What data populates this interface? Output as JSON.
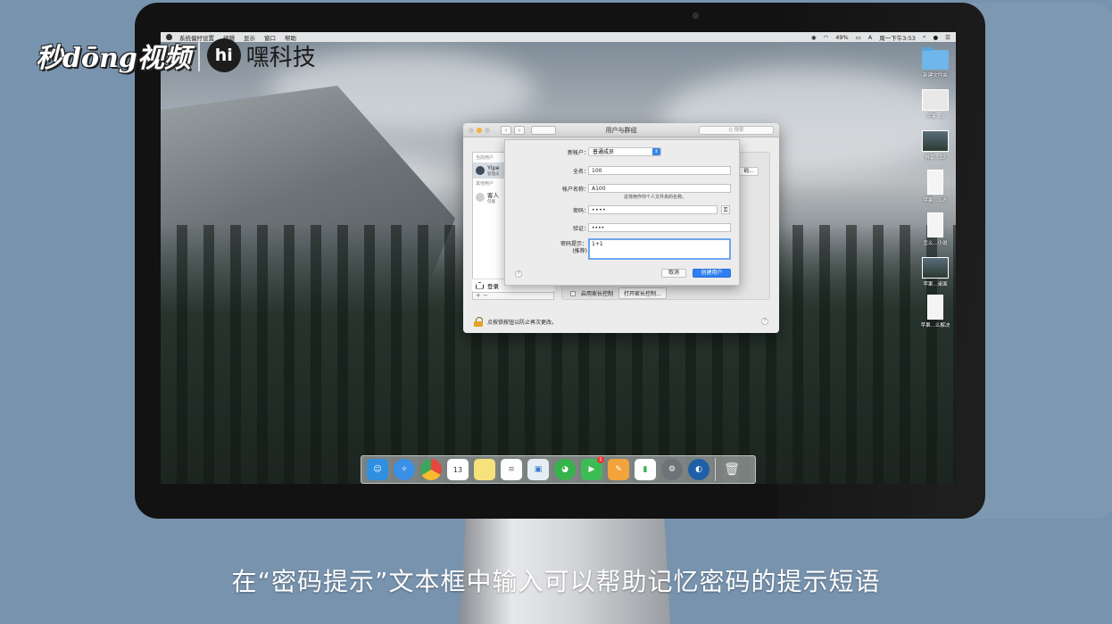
{
  "watermark": {
    "logo": "秒dōng视频",
    "hi": "hi",
    "name": "嘿科技"
  },
  "menubar": {
    "items": [
      "系统偏好设置",
      "编辑",
      "显示",
      "窗口",
      "帮助"
    ],
    "battery": "49%",
    "clock": "周一下午3:53",
    "input_method": "A"
  },
  "desktop": {
    "files": [
      {
        "label": "新建文件夹",
        "kind": "folder"
      },
      {
        "label": "苹果...1",
        "kind": "thumb"
      },
      {
        "label": "屏幕...22",
        "kind": "dark"
      },
      {
        "label": "苹果...么办",
        "kind": "tall"
      },
      {
        "label": "怎么...小说",
        "kind": "tall"
      },
      {
        "label": "苹果...桌面",
        "kind": "dark"
      },
      {
        "label": "苹果...么解决",
        "kind": "tall"
      }
    ]
  },
  "window": {
    "title": "用户与群组",
    "search_placeholder": "Q 搜索",
    "current_users_header": "当前用户",
    "current_user_name": "Yipe",
    "current_user_role": "管理员",
    "other_users_header": "其他用户",
    "guest_name": "客人",
    "guest_role": "仅能",
    "login_label": "登录",
    "plus_minus": "+ −",
    "right_button": "码...",
    "parental_checkbox": "启用家长控制",
    "parental_button": "打开家长控制...",
    "lock_text": "点按锁按钮以防止再次更改。",
    "help": "?"
  },
  "sheet": {
    "new_account_label": "新帐户：",
    "new_account_value": "普通成员",
    "fullname_label": "全名：",
    "fullname_value": "100",
    "account_label": "帐户名称：",
    "account_value": "A100",
    "account_hint": "这将用作你个人文件夹的名称。",
    "password_label": "密码：",
    "password_value": "••••",
    "verify_label": "验证：",
    "verify_value": "••••",
    "hint_label": "密码提示：",
    "hint_sub": "(推荐)",
    "hint_value": "1+1",
    "help": "?",
    "cancel": "取消",
    "create": "创建用户"
  },
  "dock": {
    "apps": [
      {
        "icon": "finder-icon",
        "glyph": "☺",
        "color": "#2f8fe0"
      },
      {
        "icon": "safari-icon",
        "glyph": "✧",
        "color": "#3a8fe6"
      },
      {
        "icon": "chrome-icon",
        "glyph": "◉",
        "color": "#e8453c"
      },
      {
        "icon": "calendar-icon",
        "glyph": "13",
        "color": "#ffffff"
      },
      {
        "icon": "notes-icon",
        "glyph": "",
        "color": "#f6e27a"
      },
      {
        "icon": "reminders-icon",
        "glyph": "≡",
        "color": "#fdfdfd"
      },
      {
        "icon": "preview-icon",
        "glyph": "▣",
        "color": "#e6eef5"
      },
      {
        "icon": "wechat-icon",
        "glyph": "◕",
        "color": "#36b34a"
      },
      {
        "icon": "facetime-icon",
        "glyph": "▶",
        "color": "#3dbb55"
      },
      {
        "icon": "pages-icon",
        "glyph": "✎",
        "color": "#f3a33b"
      },
      {
        "icon": "numbers-icon",
        "glyph": "▮",
        "color": "#3fb14c"
      },
      {
        "icon": "system-preferences-icon",
        "glyph": "⚙",
        "color": "#6e7378"
      },
      {
        "icon": "quicktime-icon",
        "glyph": "◐",
        "color": "#1e5fa8"
      }
    ],
    "facetime_badge": "1",
    "trash_glyph": "🗑"
  },
  "caption": "在“密码提示”文本框中输入可以帮助记忆密码的提示短语"
}
